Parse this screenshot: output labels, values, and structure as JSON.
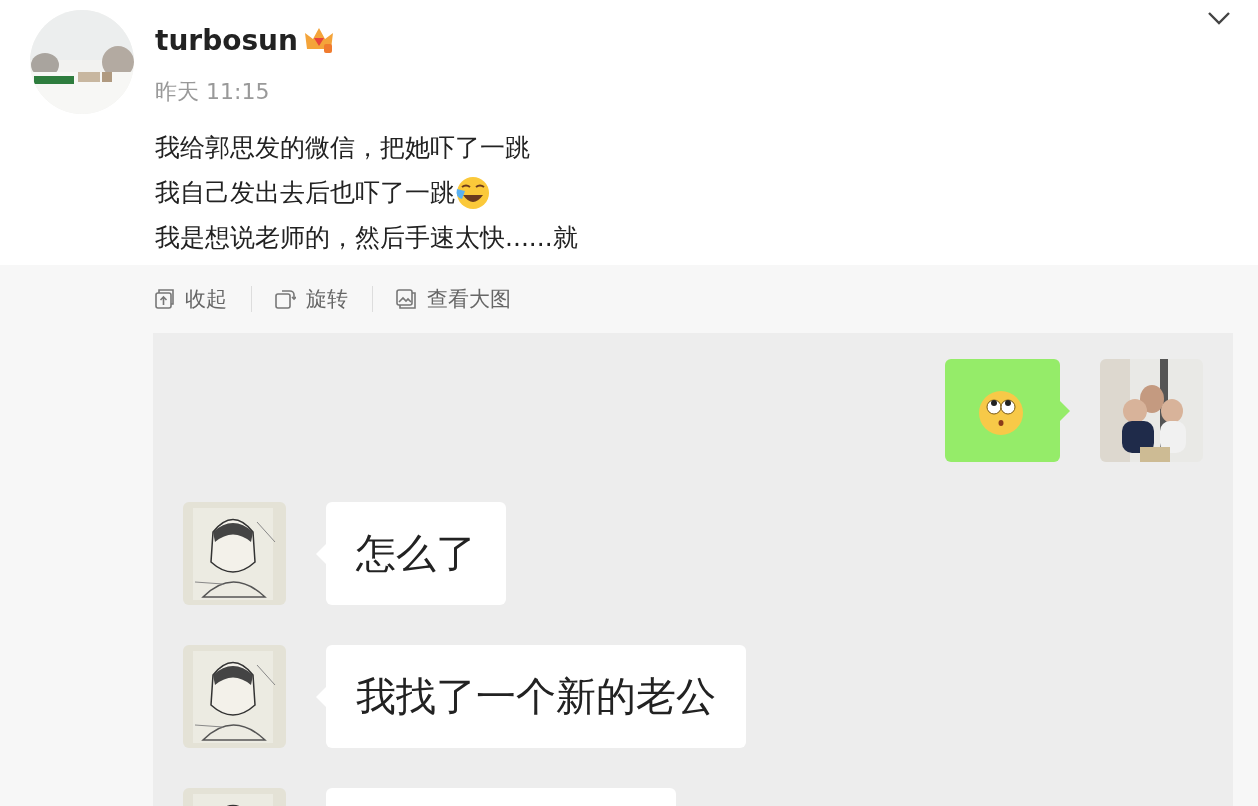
{
  "post": {
    "author": "turbosun",
    "time": "昨天 11:15",
    "lines": [
      {
        "text": "我给郭思发的微信，把她吓了一跳"
      },
      {
        "text": "我自己发出去后也吓了一跳"
      },
      {
        "text": "我是想说老师的，然后手速太快......就"
      }
    ]
  },
  "toolbar": [
    {
      "label": "收起",
      "kind": "collapse"
    },
    {
      "label": "旋转",
      "kind": "rotate"
    },
    {
      "label": "查看大图",
      "kind": "enlarge"
    }
  ],
  "chat": {
    "messages": [
      {
        "outgoing": true,
        "kind": "sticker"
      },
      {
        "outgoing": false,
        "kind": "text",
        "text": "怎么了"
      },
      {
        "outgoing": false,
        "kind": "text",
        "text": "我找了一个新的老公"
      },
      {
        "outgoing": false,
        "kind": "cut"
      }
    ]
  }
}
